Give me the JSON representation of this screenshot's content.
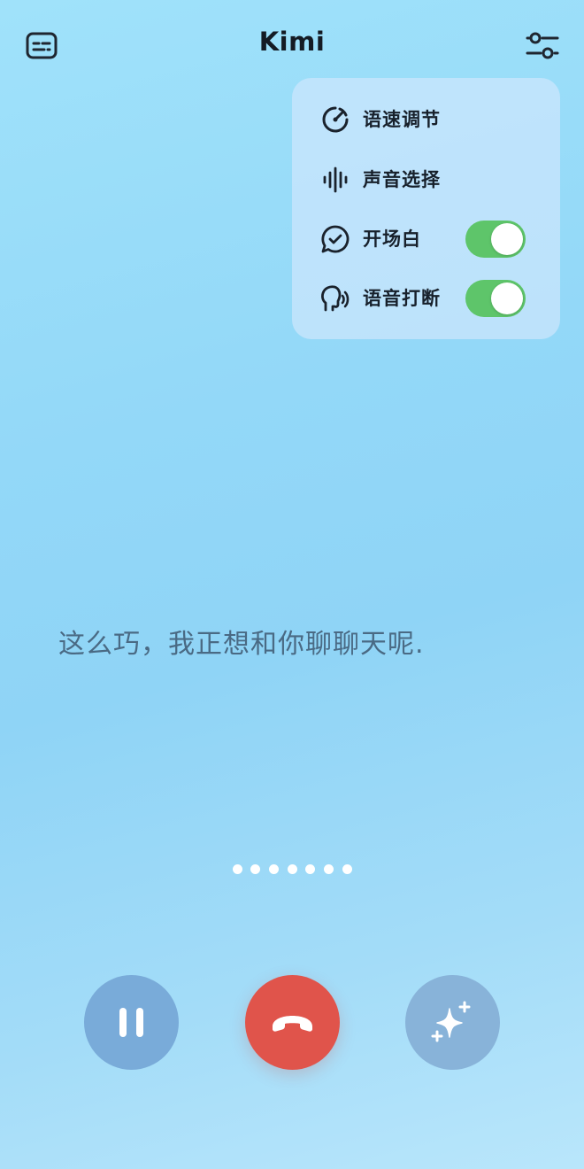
{
  "header": {
    "title": "Kimi",
    "left_icon": "subtitles-icon",
    "right_icon": "sliders-icon"
  },
  "menu": {
    "items": [
      {
        "label": "语速调节",
        "icon": "speed-gauge-icon"
      },
      {
        "label": "声音选择",
        "icon": "sound-wave-icon"
      },
      {
        "label": "开场白",
        "icon": "chat-check-icon",
        "toggle": true
      },
      {
        "label": "语音打断",
        "icon": "speaking-head-icon",
        "toggle": true
      }
    ]
  },
  "transcript": {
    "text": "这么巧，我正想和你聊聊天呢."
  },
  "pagination": {
    "dots": 7
  },
  "controls": {
    "pause_icon": "pause-icon",
    "hangup_icon": "hang-up-phone-icon",
    "magic_icon": "sparkles-icon"
  },
  "colors": {
    "toggle_on": "#5ec56a",
    "hangup": "#e0544b",
    "pause_bg": "#79abd9",
    "magic_bg": "#88b3d9",
    "transcript_text": "#4a6a84"
  }
}
